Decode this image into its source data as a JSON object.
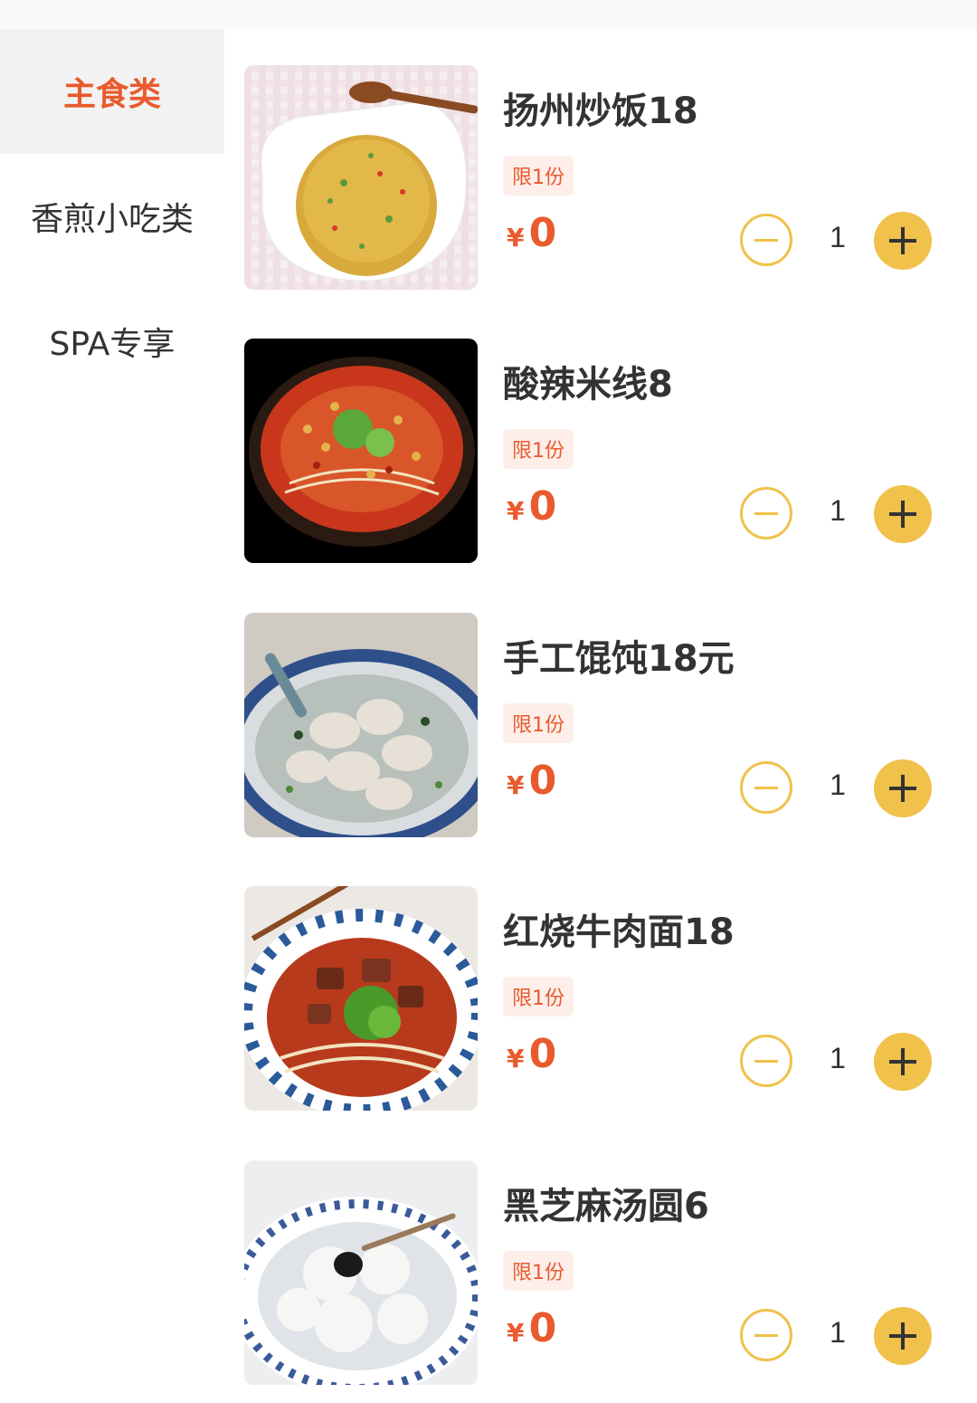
{
  "sidebar": {
    "categories": [
      {
        "label": "主食类",
        "active": true
      },
      {
        "label": "香煎小吃类",
        "active": false
      },
      {
        "label": "SPA专享",
        "active": false
      }
    ]
  },
  "items": [
    {
      "name": "扬州炒饭18",
      "limit": "限1份",
      "currency": "¥",
      "price": "0",
      "quantity": "1",
      "image": "fried-rice-photo"
    },
    {
      "name": "酸辣米线8",
      "limit": "限1份",
      "currency": "¥",
      "price": "0",
      "quantity": "1",
      "image": "hot-sour-rice-noodle-photo"
    },
    {
      "name": "手工馄饨18元",
      "limit": "限1份",
      "currency": "¥",
      "price": "0",
      "quantity": "1",
      "image": "wonton-soup-photo"
    },
    {
      "name": "红烧牛肉面18",
      "limit": "限1份",
      "currency": "¥",
      "price": "0",
      "quantity": "1",
      "image": "braised-beef-noodle-photo"
    },
    {
      "name": "黑芝麻汤圆6",
      "limit": "限1份",
      "currency": "¥",
      "price": "0",
      "quantity": "1",
      "image": "sesame-tangyuan-photo"
    }
  ],
  "colors": {
    "accent": "#e95a2c",
    "stepper": "#f0c14b",
    "active_bg": "#f2f2f2",
    "limit_bg": "#fdeeea"
  }
}
